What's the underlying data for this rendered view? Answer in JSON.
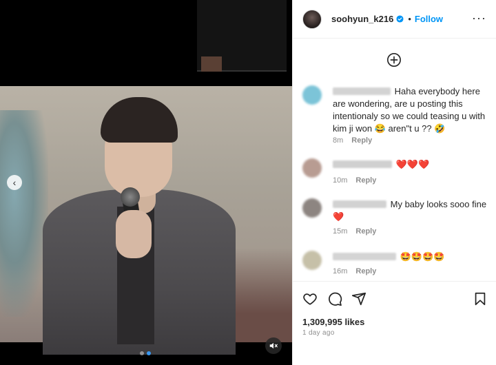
{
  "post": {
    "username": "soohyun_k216",
    "separator": "•",
    "follow_label": "Follow",
    "more_glyph": "···",
    "likes": "1,309,995 likes",
    "posted": "1 day ago"
  },
  "media": {
    "carousel_prev_glyph": "‹",
    "mute_icon": "speaker-muted-icon",
    "slides_total": 2,
    "slide_active": 2
  },
  "comments": [
    {
      "text": "Haha everybody here are wondering, are u posting this intentionaly so we could teasing u with kim ji won 😂 aren\"t u ?? 🤣",
      "time": "8m",
      "reply_label": "Reply",
      "avatar_color": "#7cc4d8"
    },
    {
      "text": "❤️❤️❤️",
      "time": "10m",
      "reply_label": "Reply",
      "avatar_color": "#b89c92"
    },
    {
      "text": "My baby looks sooo fine❤️",
      "time": "15m",
      "reply_label": "Reply",
      "avatar_color": "#8d8581"
    },
    {
      "text": "🤩🤩🤩🤩",
      "time": "16m",
      "reply_label": "Reply",
      "avatar_color": "#c6c0a8"
    }
  ],
  "colors": {
    "accent": "#0095f6",
    "muted": "#8e8e8e",
    "text": "#262626"
  },
  "icons": [
    "verified-badge-icon",
    "add-circle-icon",
    "heart-icon",
    "comment-icon",
    "share-icon",
    "bookmark-icon"
  ]
}
